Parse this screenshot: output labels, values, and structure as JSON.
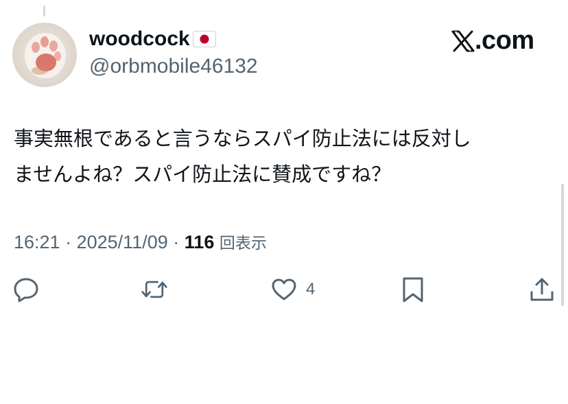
{
  "author": {
    "display_name": "woodcock",
    "flag": "japan-flag",
    "handle": "@orbmobile46132",
    "avatar": "cat-paw-photo"
  },
  "brand": {
    "logo": "x-logo",
    "text": ".com"
  },
  "tweet": {
    "lines": [
      "事実無根であると言うならスパイ防止法には反対し",
      "ませんよね？スパイ防止法に賛成ですね？"
    ]
  },
  "meta": {
    "time": "16:21",
    "separator": "·",
    "date": "2025/11/09",
    "views_count": "116",
    "views_label": "回表示"
  },
  "actions": {
    "reply_icon": "reply-icon",
    "retweet_icon": "retweet-icon",
    "like_icon": "heart-icon",
    "like_count": "4",
    "bookmark_icon": "bookmark-icon",
    "share_icon": "share-icon"
  },
  "colors": {
    "text": "#0f1419",
    "secondary": "#536471",
    "flag_red": "#bc002d"
  }
}
